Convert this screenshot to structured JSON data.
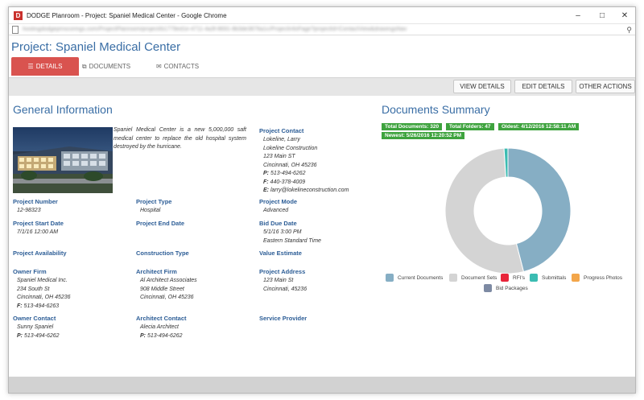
{
  "window": {
    "title": "DODGE Planroom - Project: Spaniel Medical Center - Google Chrome",
    "logo_letter": "D",
    "minimize": "–",
    "maximize": "□",
    "close": "✕"
  },
  "address": {
    "url": "hostingdodgepmscorings.com/ProjectPlanroom/project/b1779ed1e-4711-4a3f-8691-8b3de3876a1c/ProjectInfoPage?projectId=ContactView&drawingsNav"
  },
  "page": {
    "title": "Project: Spaniel Medical Center"
  },
  "tabs": [
    {
      "label": "DETAILS",
      "icon": "list-icon"
    },
    {
      "label": "DOCUMENTS",
      "icon": "documents-icon"
    },
    {
      "label": "CONTACTS",
      "icon": "envelope-icon"
    }
  ],
  "toolbar": {
    "view_details": "VIEW DETAILS",
    "edit_details": "EDIT DETAILS",
    "other_actions": "OTHER ACTIONS"
  },
  "general": {
    "title": "General Information",
    "description": "Spaniel Medical Center is a new 5,000,000 saft medical center to replace the old hospital system destroyed by the hurricane.",
    "contact": {
      "label": "Project Contact",
      "name": "Lokeline, Larry",
      "company": "Lokeline Construction",
      "street": "123 Main ST",
      "city": "Cincinnati, OH  45236",
      "phone_label": "P:",
      "phone": " 513-494-6262",
      "fax_label": "F:",
      "fax": " 440-378-4009",
      "email_label": "E:",
      "email": " larry@lokelineconstruction.com"
    },
    "number": {
      "label": "Project Number",
      "value": "12-98323"
    },
    "type": {
      "label": "Project Type",
      "value": "Hospital"
    },
    "mode": {
      "label": "Project Mode",
      "value": "Advanced"
    },
    "start_date": {
      "label": "Project Start Date",
      "value": "7/1/16 12:00 AM"
    },
    "end_date": {
      "label": "Project End Date",
      "value": ""
    },
    "bid_due": {
      "label": "Bid Due Date",
      "date": "5/1/16 3:00 PM",
      "zone": "Eastern Standard Time"
    },
    "availability": {
      "label": "Project Availability",
      "value": ""
    },
    "construction_type": {
      "label": "Construction Type",
      "value": ""
    },
    "value_estimate": {
      "label": "Value Estimate",
      "value": ""
    },
    "owner_firm": {
      "label": "Owner Firm",
      "name": "Spaniel Medical Inc.",
      "street": "234 South St",
      "city": "Cincinnati, OH  45236",
      "fax_label": "F:",
      "fax": " 513-494-6263"
    },
    "architect_firm": {
      "label": "Architect Firm",
      "name": "Al Architect Associates",
      "street": "908 Middle Street",
      "city": "Cincinnati, OH  45236"
    },
    "project_address": {
      "label": "Project Address",
      "street": "123 Main St",
      "city": "Cincinnati, 45236"
    },
    "owner_contact": {
      "label": "Owner Contact",
      "name": "Sunny Spaniel",
      "phone_label": "P:",
      "phone": " 513-494-6262"
    },
    "architect_contact": {
      "label": "Architect Contact",
      "name": "Alecia Architect",
      "phone_label": "P:",
      "phone": " 513-494-6262"
    },
    "service_provider": {
      "label": "Service Provider",
      "value": ""
    }
  },
  "documents": {
    "title": "Documents Summary",
    "badges": {
      "total_documents": "Total Documents: 320",
      "total_folders": "Total Folders: 47",
      "oldest": "Oldest: 4/12/2016 12:58:11 AM",
      "newest": "Newest: 5/26/2016 12:20:52 PM"
    },
    "legend": [
      {
        "label": "Current Documents",
        "color": "#86aec4"
      },
      {
        "label": "Document Sets",
        "color": "#d4d4d4"
      },
      {
        "label": "RFI's",
        "color": "#e8253a"
      },
      {
        "label": "Submittals",
        "color": "#3bbcb2"
      },
      {
        "label": "Progress Photos",
        "color": "#f3a64a"
      },
      {
        "label": "Bid Packages",
        "color": "#7d8aa3"
      }
    ]
  },
  "chart_data": {
    "type": "pie",
    "title": "",
    "labels": [
      "Current Documents",
      "Document Sets",
      "RFI's",
      "Submittals",
      "Progress Photos",
      "Bid Packages"
    ],
    "values": [
      46,
      53,
      0,
      1,
      0,
      0
    ],
    "colors": [
      "#86aec4",
      "#d4d4d4",
      "#e8253a",
      "#3bbcb2",
      "#f3a64a",
      "#7d8aa3"
    ]
  }
}
